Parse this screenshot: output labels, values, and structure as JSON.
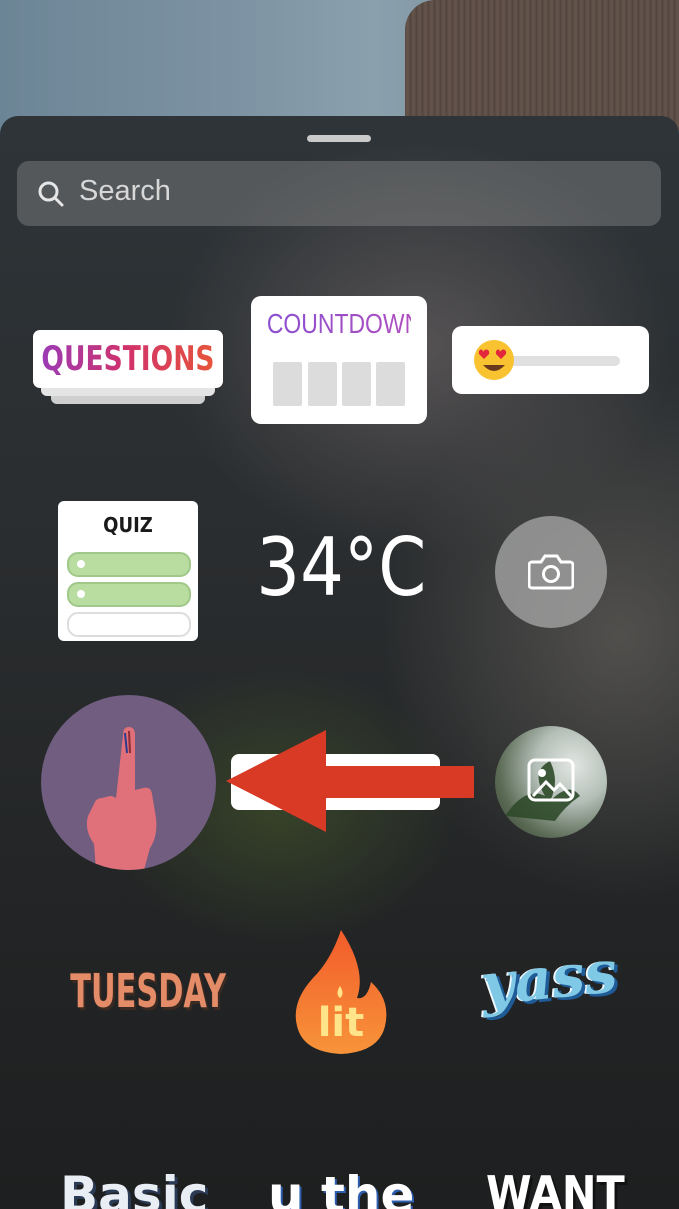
{
  "search": {
    "placeholder": "Search"
  },
  "stickers": {
    "questions": {
      "label": "QUESTIONS"
    },
    "countdown": {
      "label": "COUNTDOWN"
    },
    "slider": {
      "emoji": "😍"
    },
    "quiz": {
      "label": "QUIZ"
    },
    "temperature": {
      "label": "34°C"
    },
    "camera": {
      "icon": "camera-icon"
    },
    "vote": {
      "icon": "voting-finger-icon"
    },
    "gallery": {
      "icon": "image-icon"
    },
    "day": {
      "label": "TUESDAY"
    },
    "lit": {
      "label": "lit"
    },
    "yass": {
      "label": "yass"
    },
    "basic": {
      "label": "Basic"
    },
    "uthe": {
      "label": "u the"
    },
    "want": {
      "label": "WANT"
    }
  },
  "colors": {
    "annotation_arrow": "#d83a26",
    "vote_bg": "#705d80",
    "quiz_option_green": "#b9dca0"
  }
}
